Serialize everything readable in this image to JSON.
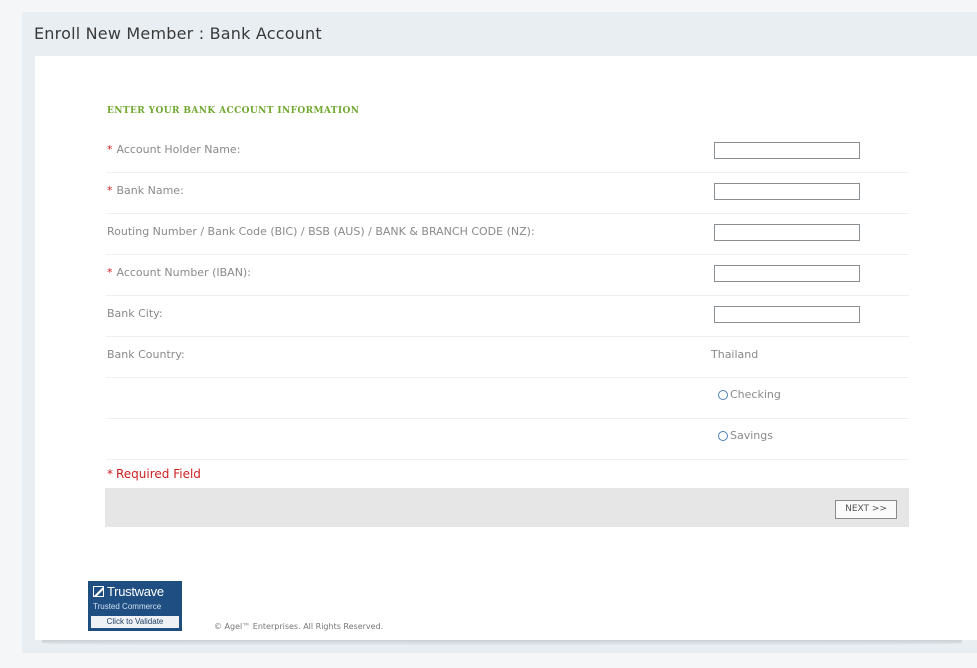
{
  "page": {
    "title": "Enroll New Member : Bank Account"
  },
  "section": {
    "heading": "ENTER YOUR BANK ACCOUNT INFORMATION"
  },
  "form": {
    "required_marker": "*",
    "fields": [
      {
        "label": "Account Holder Name:",
        "required": true,
        "value": ""
      },
      {
        "label": "Bank Name:",
        "required": true,
        "value": ""
      },
      {
        "label": "Routing Number / Bank Code (BIC) / BSB (AUS) / BANK & BRANCH CODE (NZ):",
        "required": false,
        "value": ""
      },
      {
        "label": "Account Number (IBAN):",
        "required": true,
        "value": ""
      },
      {
        "label": "Bank City:",
        "required": false,
        "value": ""
      }
    ],
    "country": {
      "label": "Bank Country:",
      "value": "Thailand"
    },
    "account_type": {
      "options": [
        "Checking",
        "Savings"
      ],
      "selected": null
    },
    "required_note": "Required Field",
    "next_label": "NEXT >>"
  },
  "footer": {
    "badge": {
      "brand": "Trustwave",
      "subtitle": "Trusted Commerce",
      "validate": "Click to Validate"
    },
    "copyright": "© Agel™ Enterprises. All Rights Reserved."
  },
  "colors": {
    "heading_green": "#70a830",
    "required_red": "#cc2020",
    "badge_blue": "#1f4f82"
  }
}
